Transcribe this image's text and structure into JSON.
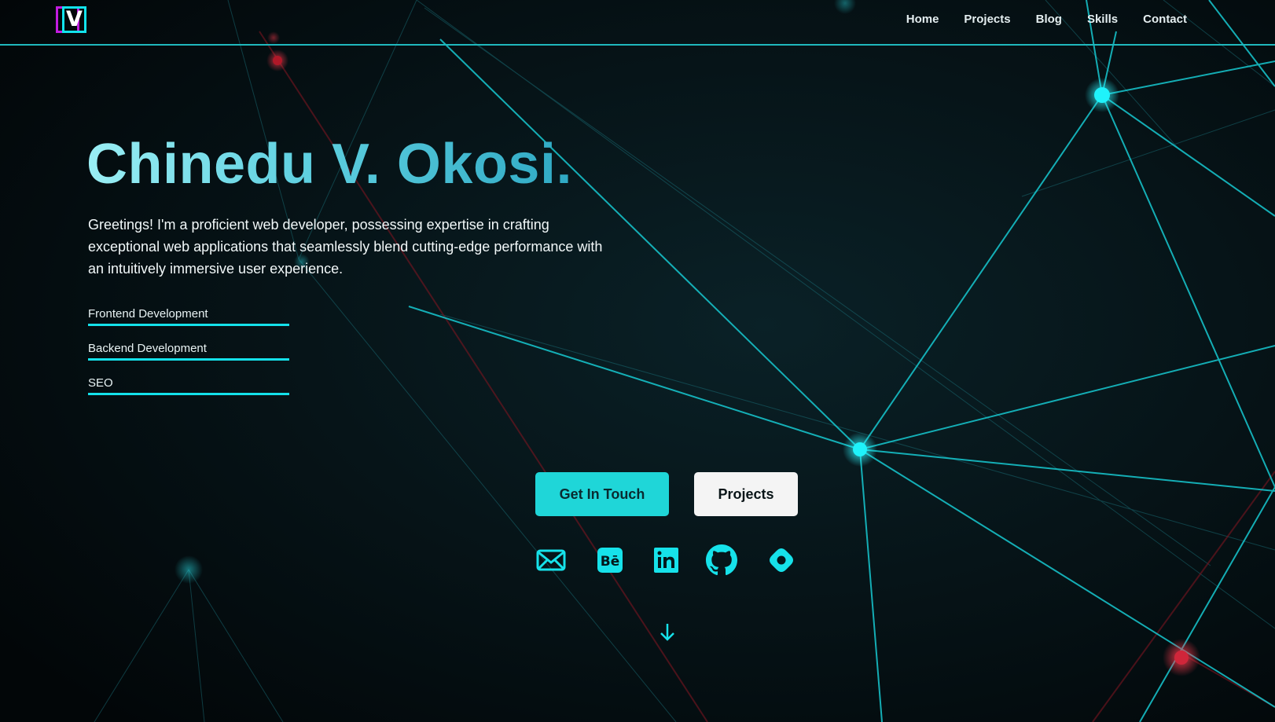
{
  "nav": {
    "logo_letter": "V",
    "links": [
      "Home",
      "Projects",
      "Blog",
      "Skills",
      "Contact"
    ]
  },
  "hero": {
    "title": "Chinedu V. Okosi.",
    "description": "Greetings! I'm a proficient web developer, possessing expertise in crafting exceptional web applications that seamlessly blend cutting-edge performance with an intuitively immersive user experience.",
    "skills": [
      "Frontend Development",
      "Backend Development",
      "SEO"
    ]
  },
  "buttons": {
    "primary_label": "Get In Touch",
    "secondary_label": "Projects"
  },
  "socials": [
    "mail-icon",
    "behance-icon",
    "linkedin-icon",
    "github-icon",
    "hashnode-icon"
  ],
  "colors": {
    "accent": "#14e1ea",
    "background": "#03090c",
    "logo_magenta": "#c21ce0",
    "node_red": "#e0263b"
  }
}
